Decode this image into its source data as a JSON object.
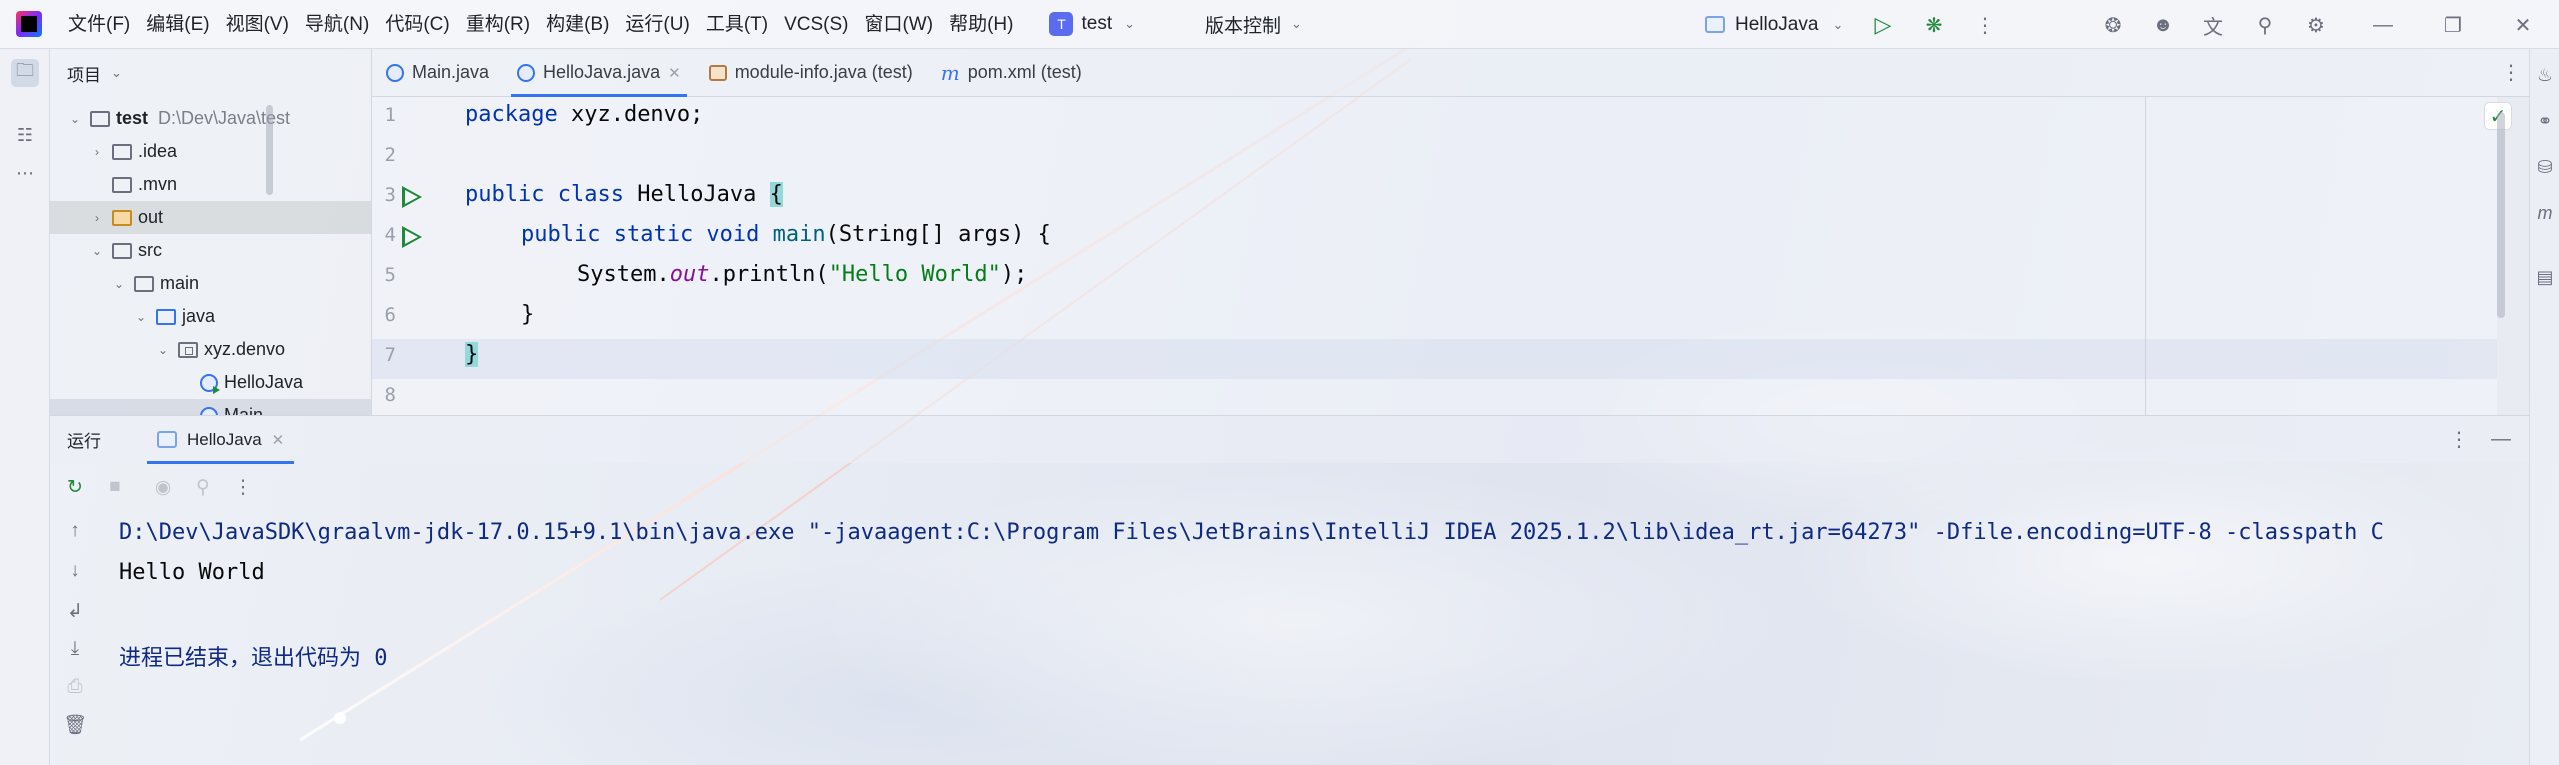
{
  "menu": [
    "文件(F)",
    "编辑(E)",
    "视图(V)",
    "导航(N)",
    "代码(C)",
    "重构(R)",
    "构建(B)",
    "运行(U)",
    "工具(T)",
    "VCS(S)",
    "窗口(W)",
    "帮助(H)"
  ],
  "project_widget": {
    "badge": "T",
    "name": "test"
  },
  "vcs_widget": {
    "label": "版本控制"
  },
  "run_config": {
    "name": "HelloJava"
  },
  "project_panel": {
    "title": "项目",
    "tree": [
      {
        "label": "test",
        "extra": "D:\\Dev\\Java\\test"
      },
      {
        "label": ".idea"
      },
      {
        "label": ".mvn"
      },
      {
        "label": "out"
      },
      {
        "label": "src"
      },
      {
        "label": "main"
      },
      {
        "label": "java"
      },
      {
        "label": "xyz.denvo"
      },
      {
        "label": "HelloJava"
      },
      {
        "label": "Main"
      }
    ]
  },
  "editor_tabs": [
    {
      "label": "Main.java"
    },
    {
      "label": "HelloJava.java",
      "active": true
    },
    {
      "label": "module-info.java (test)"
    },
    {
      "label": "pom.xml (test)"
    }
  ],
  "editor": {
    "line_numbers": [
      "1",
      "2",
      "3",
      "4",
      "5",
      "6",
      "7",
      "8"
    ],
    "code": {
      "l1_kw": "package",
      "l1_rest": " xyz.denvo;",
      "l3_kw1": "public",
      "l3_kw2": "class",
      "l3_name": " HelloJava ",
      "l3_brace": "{",
      "l4_kw": "public static void",
      "l4_fn": "main",
      "l4_rest": "(String[] args) {",
      "l5_a": "System.",
      "l5_fld": "out",
      "l5_b": ".println(",
      "l5_str": "\"Hello World\"",
      "l5_c": ");",
      "l6": "}",
      "l7": "}"
    }
  },
  "run_panel": {
    "title": "运行",
    "tab_label": "HelloJava",
    "console": {
      "cmd": "D:\\Dev\\JavaSDK\\graalvm-jdk-17.0.15+9.1\\bin\\java.exe \"-javaagent:C:\\Program Files\\JetBrains\\IntelliJ IDEA 2025.1.2\\lib\\idea_rt.jar=64273\" -Dfile.encoding=UTF-8 -classpath C",
      "output": "Hello World",
      "exit": "进程已结束，退出代码为 0"
    }
  },
  "colors": {
    "accent": "#3574f0",
    "run_green": "#208a3c",
    "keyword": "#0033b3",
    "string": "#067d17"
  }
}
